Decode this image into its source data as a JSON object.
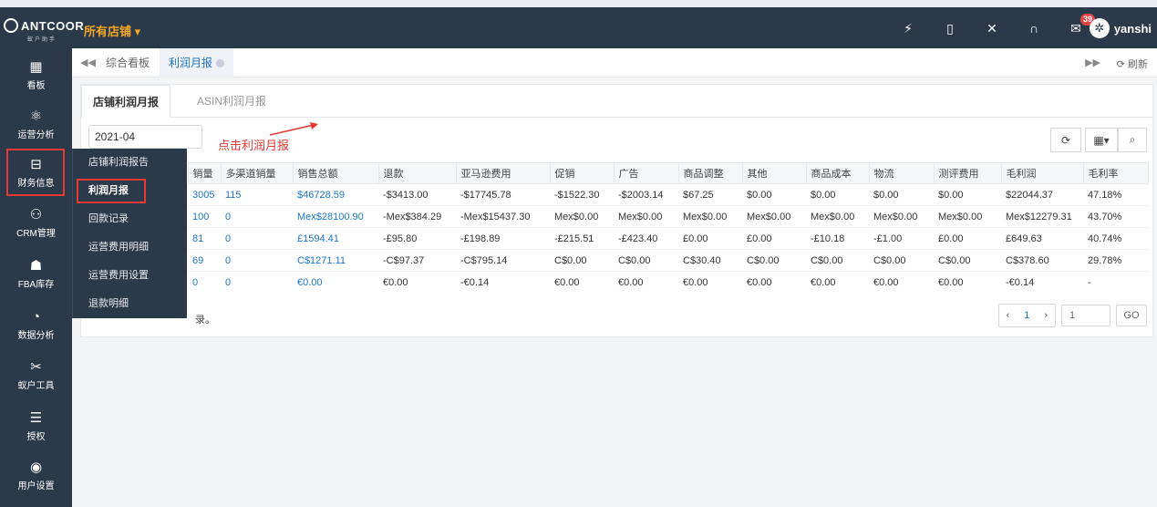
{
  "topbar": {
    "logo_text": "ANTCOOR",
    "logo_sub": "蚁户助手",
    "store_selector": "所有店铺 ▾",
    "message_count": "39",
    "username": "yanshi"
  },
  "sidebar": {
    "items": [
      {
        "label": "看板",
        "icon": "dashboard-icon"
      },
      {
        "label": "运营分析",
        "icon": "analysis-icon"
      },
      {
        "label": "财务信息",
        "icon": "finance-icon"
      },
      {
        "label": "CRM管理",
        "icon": "crm-icon"
      },
      {
        "label": "FBA库存",
        "icon": "inventory-icon"
      },
      {
        "label": "数据分析",
        "icon": "data-icon"
      },
      {
        "label": "蚁户工具",
        "icon": "tools-icon"
      },
      {
        "label": "授权",
        "icon": "authorize-icon"
      },
      {
        "label": "用户设置",
        "icon": "user-settings-icon"
      }
    ]
  },
  "submenu": {
    "items": [
      "店铺利润报告",
      "利润月报",
      "回款记录",
      "运营费用明细",
      "运营费用设置",
      "退款明细"
    ]
  },
  "tabbar": {
    "tabs": [
      "综合看板",
      "利润月报"
    ],
    "refresh": "刷新"
  },
  "panel": {
    "subtabs": [
      "店铺利润月报",
      "ASIN利润月报"
    ],
    "month": "2021-04",
    "annotation": "点击利润月报",
    "footer_partial": "录。"
  },
  "table": {
    "headers": [
      "销量",
      "多渠道销量",
      "销售总额",
      "退款",
      "亚马逊费用",
      "促销",
      "广告",
      "商品调整",
      "其他",
      "商品成本",
      "物流",
      "测评费用",
      "毛利润",
      "毛利率"
    ],
    "rows": [
      [
        "3005",
        "115",
        "$46728.59",
        "-$3413.00",
        "-$17745.78",
        "-$1522.30",
        "-$2003.14",
        "$67.25",
        "$0.00",
        "$0.00",
        "$0.00",
        "$0.00",
        "$22044.37",
        "47.18%"
      ],
      [
        "100",
        "0",
        "Mex$28100.90",
        "-Mex$384.29",
        "-Mex$15437.30",
        "Mex$0.00",
        "Mex$0.00",
        "Mex$0.00",
        "Mex$0.00",
        "Mex$0.00",
        "Mex$0.00",
        "Mex$0.00",
        "Mex$12279.31",
        "43.70%"
      ],
      [
        "81",
        "0",
        "£1594.41",
        "-£95.80",
        "-£198.89",
        "-£215.51",
        "-£423.40",
        "£0.00",
        "£0.00",
        "-£10.18",
        "-£1.00",
        "£0.00",
        "£649.63",
        "40.74%"
      ],
      [
        "69",
        "0",
        "C$1271.11",
        "-C$97.37",
        "-C$795.14",
        "C$0.00",
        "C$0.00",
        "C$30.40",
        "C$0.00",
        "C$0.00",
        "C$0.00",
        "C$0.00",
        "C$378.60",
        "29.78%"
      ],
      [
        "0",
        "0",
        "€0.00",
        "€0.00",
        "-€0.14",
        "€0.00",
        "€0.00",
        "€0.00",
        "€0.00",
        "€0.00",
        "€0.00",
        "€0.00",
        "-€0.14",
        "-"
      ]
    ]
  },
  "pager": {
    "prev": "‹",
    "page": "1",
    "next": "›",
    "jump_value": "1",
    "go": "GO"
  }
}
